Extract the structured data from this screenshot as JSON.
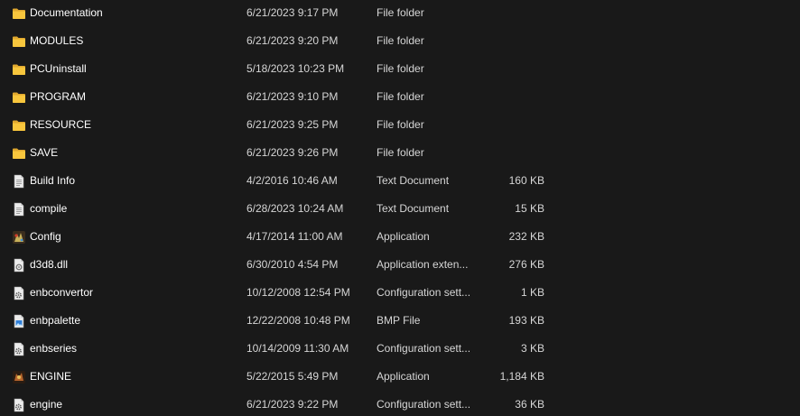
{
  "files": [
    {
      "name": "Documentation",
      "date": "6/21/2023 9:17 PM",
      "type": "File folder",
      "size": "",
      "icon": "folder-icon"
    },
    {
      "name": "MODULES",
      "date": "6/21/2023 9:20 PM",
      "type": "File folder",
      "size": "",
      "icon": "folder-icon"
    },
    {
      "name": "PCUninstall",
      "date": "5/18/2023 10:23 PM",
      "type": "File folder",
      "size": "",
      "icon": "folder-icon"
    },
    {
      "name": "PROGRAM",
      "date": "6/21/2023 9:10 PM",
      "type": "File folder",
      "size": "",
      "icon": "folder-icon"
    },
    {
      "name": "RESOURCE",
      "date": "6/21/2023 9:25 PM",
      "type": "File folder",
      "size": "",
      "icon": "folder-icon"
    },
    {
      "name": "SAVE",
      "date": "6/21/2023 9:26 PM",
      "type": "File folder",
      "size": "",
      "icon": "folder-icon"
    },
    {
      "name": "Build Info",
      "date": "4/2/2016 10:46 AM",
      "type": "Text Document",
      "size": "160 KB",
      "icon": "text-document-icon"
    },
    {
      "name": "compile",
      "date": "6/28/2023 10:24 AM",
      "type": "Text Document",
      "size": "15 KB",
      "icon": "text-document-icon"
    },
    {
      "name": "Config",
      "date": "4/17/2014 11:00 AM",
      "type": "Application",
      "size": "232 KB",
      "icon": "application-icon"
    },
    {
      "name": "d3d8.dll",
      "date": "6/30/2010 4:54 PM",
      "type": "Application exten...",
      "size": "276 KB",
      "icon": "dll-file-icon"
    },
    {
      "name": "enbconvertor",
      "date": "10/12/2008 12:54 PM",
      "type": "Configuration sett...",
      "size": "1 KB",
      "icon": "config-file-icon"
    },
    {
      "name": "enbpalette",
      "date": "12/22/2008 10:48 PM",
      "type": "BMP File",
      "size": "193 KB",
      "icon": "image-file-icon"
    },
    {
      "name": "enbseries",
      "date": "10/14/2009 11:30 AM",
      "type": "Configuration sett...",
      "size": "3 KB",
      "icon": "config-file-icon"
    },
    {
      "name": "ENGINE",
      "date": "5/22/2015 5:49 PM",
      "type": "Application",
      "size": "1,184 KB",
      "icon": "engine-application-icon"
    },
    {
      "name": "engine",
      "date": "6/21/2023 9:22 PM",
      "type": "Configuration sett...",
      "size": "36 KB",
      "icon": "config-file-icon"
    }
  ],
  "colors": {
    "background": "#191919",
    "text": "#ffffff",
    "folder": "#f8c63d",
    "document": "#ececec"
  }
}
